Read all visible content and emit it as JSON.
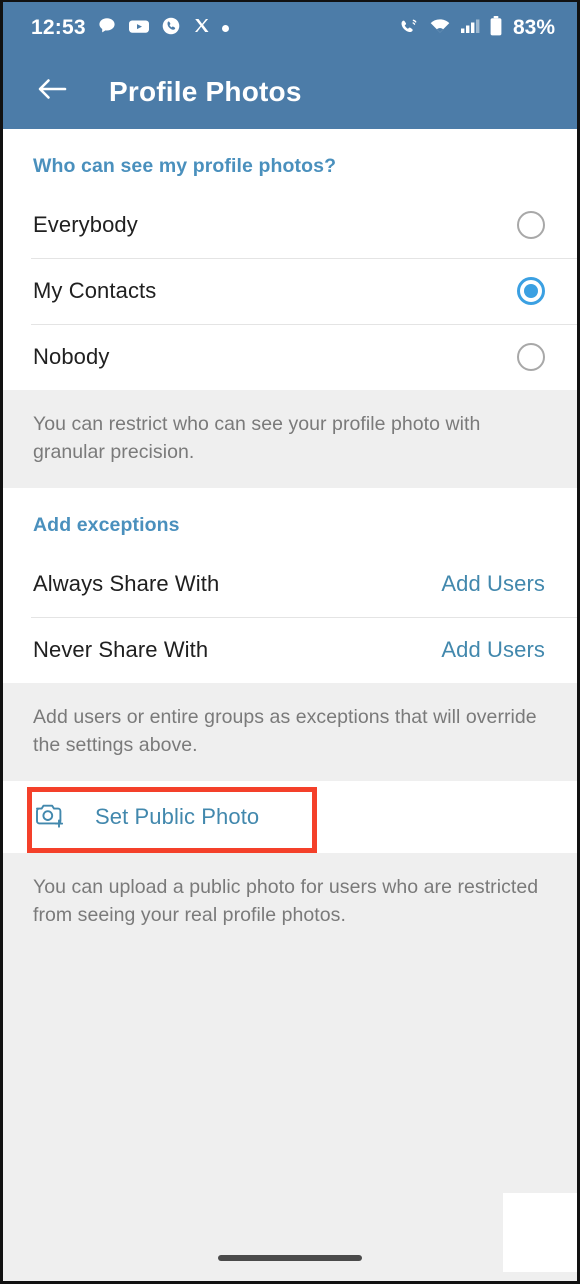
{
  "status_bar": {
    "time": "12:53",
    "battery_percent": "83%",
    "left_icons": [
      "chat-bubble-icon",
      "youtube-icon",
      "phone-circle-icon",
      "x-twitter-icon",
      "dot-icon"
    ],
    "right_icons": [
      "call-signal-icon",
      "wifi-icon",
      "cellular-signal-icon",
      "battery-icon"
    ]
  },
  "app_bar": {
    "back_icon": "back-arrow-icon",
    "title": "Profile Photos"
  },
  "visibility_section": {
    "header": "Who can see my profile photos?",
    "options": [
      {
        "label": "Everybody",
        "selected": false
      },
      {
        "label": "My Contacts",
        "selected": true
      },
      {
        "label": "Nobody",
        "selected": false
      }
    ],
    "note": "You can restrict who can see your profile photo with granular precision."
  },
  "exceptions_section": {
    "header": "Add exceptions",
    "rows": [
      {
        "label": "Always Share With",
        "action": "Add Users"
      },
      {
        "label": "Never Share With",
        "action": "Add Users"
      }
    ],
    "note": "Add users or entire groups as exceptions that will override the settings above."
  },
  "public_photo_section": {
    "icon": "camera-plus-icon",
    "label": "Set Public Photo",
    "note": "You can upload a public photo for users who are restricted from seeing your real profile photos.",
    "highlighted": true
  },
  "colors": {
    "app_bar": "#4c7ca8",
    "accent_blue": "#4288ad",
    "section_header_blue": "#4a90bd",
    "radio_selected": "#3ba0e2",
    "highlight_red": "#f4402a",
    "background_gray": "#efefef"
  }
}
